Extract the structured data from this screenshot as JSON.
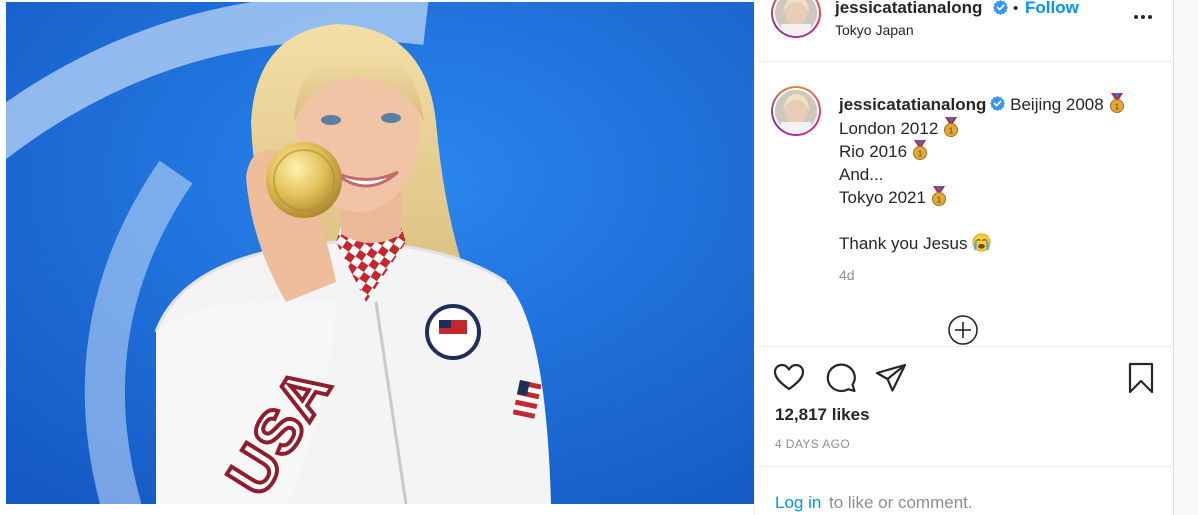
{
  "post": {
    "username": "jessicatatianalong",
    "verified": true,
    "follow_label": "Follow",
    "separator": "•",
    "location": "Tokyo Japan",
    "caption_lines": [
      {
        "text": "Beijing 2008",
        "emoji": "medal"
      },
      {
        "text": "London 2012",
        "emoji": "medal"
      },
      {
        "text": "Rio 2016",
        "emoji": "medal"
      },
      {
        "text": "And...",
        "emoji": ""
      },
      {
        "text": "Tokyo 2021",
        "emoji": "medal"
      },
      {
        "text": "",
        "emoji": ""
      },
      {
        "text": "Thank you Jesus",
        "emoji": "crying-face"
      }
    ],
    "caption_age": "4d",
    "likes": "12,817 likes",
    "posted_ago": "4 DAYS AGO",
    "login_link": "Log in",
    "login_rest": "to like or comment."
  },
  "icons": {
    "more": "more-horizontal-icon",
    "like": "heart-icon",
    "comment": "comment-icon",
    "share": "share-icon",
    "save": "bookmark-icon",
    "load_more": "plus-circle-icon"
  },
  "colors": {
    "accent": "#0095f6",
    "text": "#262626",
    "muted": "#8e8e8e",
    "photo_bg": "#1f6fd8"
  }
}
